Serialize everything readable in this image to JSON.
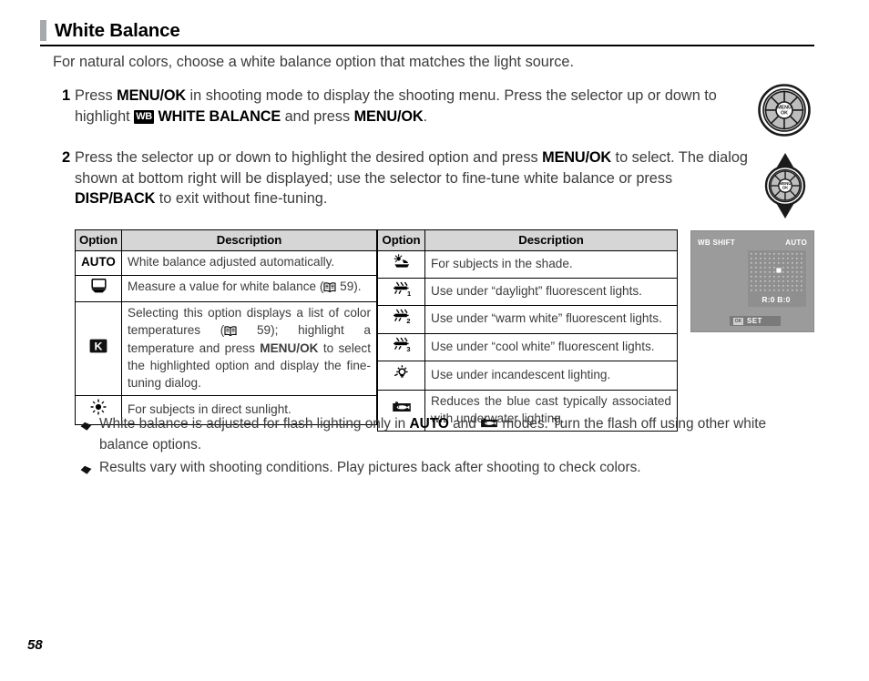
{
  "section": {
    "title": "White Balance",
    "intro": "For natural colors, choose a white balance option that matches the light source."
  },
  "steps": [
    {
      "number": "1",
      "text_1": "Press ",
      "bold_1": "MENU/OK",
      "text_2": " in shooting mode to display the shooting menu.  Press the selector up or down to highlight ",
      "icon": "wb-badge",
      "icon_label": "WB",
      "bold_2": "WHITE BALANCE",
      "text_3": " and press ",
      "bold_3": "MENU/OK",
      "text_4": ".",
      "dial_icon": "selector-dial-menu-ok"
    },
    {
      "number": "2",
      "text_1": "Press the selector up or down to highlight the desired option and press ",
      "bold_1": "MENU/OK",
      "text_2": " to select.  The dialog shown at bottom right will be displayed; use the selector to fine-tune white balance or press ",
      "bold_2": "DISP/BACK",
      "text_3": " to exit without fine-tuning.",
      "dial_icon": "selector-dial-up-down"
    }
  ],
  "left_table": {
    "headers": [
      "Option",
      "Description"
    ],
    "rows": [
      {
        "option": "AUTO",
        "option_type": "text",
        "description": "White balance adjusted automatically.",
        "justify": false
      },
      {
        "option": "custom-wb-icon",
        "option_type": "icon",
        "description_pre": "Measure a value for white balance (",
        "description_ref": "59",
        "description_post": ").",
        "has_book_ref": true,
        "justify": false
      },
      {
        "option": "kelvin-icon",
        "option_type": "icon",
        "description_pre": "Selecting this option displays a list of color temperatures (",
        "description_ref": "59",
        "description_post": "); highlight a temperature and press ",
        "description_bold": "MENU/OK",
        "description_tail": " to select the highlighted option and display the fine-tuning dialog.",
        "has_book_ref": true,
        "justify": true
      },
      {
        "option": "direct-sunlight-icon",
        "option_type": "icon",
        "description": "For subjects in direct sunlight.",
        "justify": false
      }
    ]
  },
  "right_table": {
    "headers": [
      "Option",
      "Description"
    ],
    "rows": [
      {
        "option": "shade-icon",
        "description": "For subjects in the shade.",
        "justify": false
      },
      {
        "option": "fluorescent-1-icon",
        "description": "Use under “daylight” fluorescent lights.",
        "justify": false
      },
      {
        "option": "fluorescent-2-icon",
        "description": "Use under “warm white” fluorescent lights.",
        "justify": false
      },
      {
        "option": "fluorescent-3-icon",
        "description": "Use under “cool white” fluorescent lights.",
        "justify": false
      },
      {
        "option": "incandescent-icon",
        "description": "Use under incandescent lighting.",
        "justify": false
      },
      {
        "option": "underwater-icon",
        "description": "Reduces the blue cast typically associated with underwater lighting.",
        "justify": true
      }
    ]
  },
  "lcd": {
    "title": "WB SHIFT",
    "mode": "AUTO",
    "readout": "R:0  B:0",
    "menu_badge": "MENU/OK",
    "set_label": "SET"
  },
  "notes": [
    {
      "text_1": "White balance is adjusted for flash lighting only in ",
      "bold_1": "AUTO",
      "text_2": " and ",
      "icon": "underwater-icon",
      "text_3": " modes.  Turn the flash off using other white balance options."
    },
    {
      "text_1": "Results vary with shooting conditions.  Play pictures back after shooting to check colors."
    }
  ],
  "folio": "58",
  "colors": {
    "header_bar": "#a7a9ac",
    "table_header_bg": "#d6d6d6",
    "body_text": "#3c3c3c",
    "lcd_bg": "#9b9b9b",
    "lcd_panel": "#8f8f8f",
    "rule": "#000000"
  }
}
